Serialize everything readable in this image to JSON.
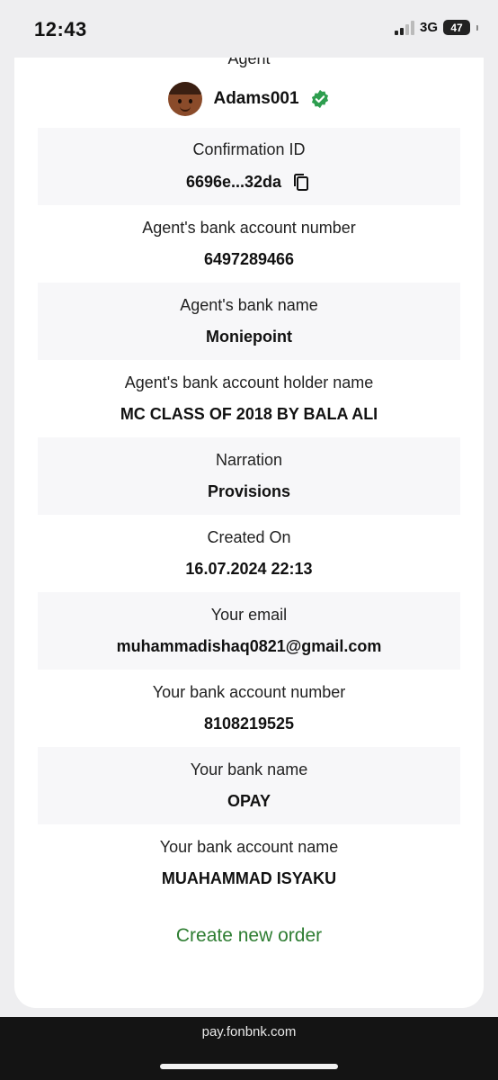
{
  "status_bar": {
    "time": "12:43",
    "network": "3G",
    "battery": "47"
  },
  "agent": {
    "section_label": "Agent",
    "name": "Adams001",
    "verified_icon": "verified-check-icon",
    "verified_color": "#2e9e4f"
  },
  "details": [
    {
      "label": "Confirmation ID",
      "value": "6696e...32da",
      "copyable": true
    },
    {
      "label": "Agent's bank account number",
      "value": "6497289466"
    },
    {
      "label": "Agent's bank name",
      "value": "Moniepoint"
    },
    {
      "label": "Agent's bank account holder name",
      "value": "MC CLASS OF 2018 BY BALA ALI"
    },
    {
      "label": "Narration",
      "value": "Provisions"
    },
    {
      "label": "Created On",
      "value": "16.07.2024 22:13"
    },
    {
      "label": "Your email",
      "value": "muhammadishaq0821@gmail.com"
    },
    {
      "label": "Your bank account number",
      "value": "8108219525"
    },
    {
      "label": "Your bank name",
      "value": "OPAY"
    },
    {
      "label": "Your bank account name",
      "value": "MUAHAMMAD ISYAKU"
    }
  ],
  "actions": {
    "create_new_order": "Create new order",
    "accent_color": "#2e7d32"
  },
  "browser": {
    "url": "pay.fonbnk.com"
  }
}
